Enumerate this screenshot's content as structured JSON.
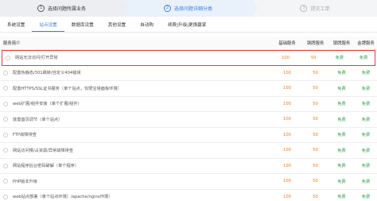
{
  "steps": [
    {
      "num": "1",
      "label": "选择问题所属业务"
    },
    {
      "num": "2",
      "label": "选择问题详细分类"
    },
    {
      "num": "3",
      "label": "提交工单"
    }
  ],
  "tabs": [
    "系统设置",
    "站点设置",
    "数据库设置",
    "其他设置",
    "自动购",
    "续费|升级|更换赢家"
  ],
  "active_tab": 1,
  "table": {
    "headers": [
      "服务简介",
      "基础服务",
      "钢牌服务",
      "银牌服务",
      "金牌服务"
    ],
    "rows": [
      {
        "name": "网站无法访问/打开异常",
        "prices": [
          "100",
          "50",
          "免费",
          "免费"
        ],
        "highlight": true
      },
      {
        "name": "配置伪静态/301跳转/自定义404错误",
        "prices": [
          "100",
          "50",
          "免费",
          "免费"
        ]
      },
      {
        "name": "配置HTTPS/SSL证书服务（单个站点，仅限宝塔面板环境）",
        "prices": [
          "100",
          "50",
          "免费",
          "免费"
        ]
      },
      {
        "name": "web扩展/组件安装（单个扩展/组件）",
        "prices": [
          "100",
          "50",
          "免费",
          "免费"
        ]
      },
      {
        "name": "放置首页调节（单个站点）",
        "prices": [
          "100",
          "50",
          "免费",
          "免费"
        ]
      },
      {
        "name": "FTP故障排查",
        "prices": [
          "100",
          "50",
          "免费",
          "免费"
        ]
      },
      {
        "name": "网站访问慢/占资源/异常故障排查",
        "prices": [
          "100",
          "50",
          "免费",
          "免费"
        ]
      },
      {
        "name": "网站程序后台密码破解（单个程序）",
        "prices": [
          "100",
          "50",
          "免费",
          "免费"
        ]
      },
      {
        "name": "PHP版本升级",
        "prices": [
          "100",
          "50",
          "免费",
          "免费"
        ]
      },
      {
        "name": "web站点部署（单个站点环境）/apache/nginx环境）",
        "prices": [
          "100",
          "50",
          "免费",
          "免费"
        ]
      }
    ]
  },
  "colors": {
    "accent": "#3a82d6",
    "price": "#f47a20",
    "free": "#2fa24a",
    "highlight": "#e53b3b"
  }
}
